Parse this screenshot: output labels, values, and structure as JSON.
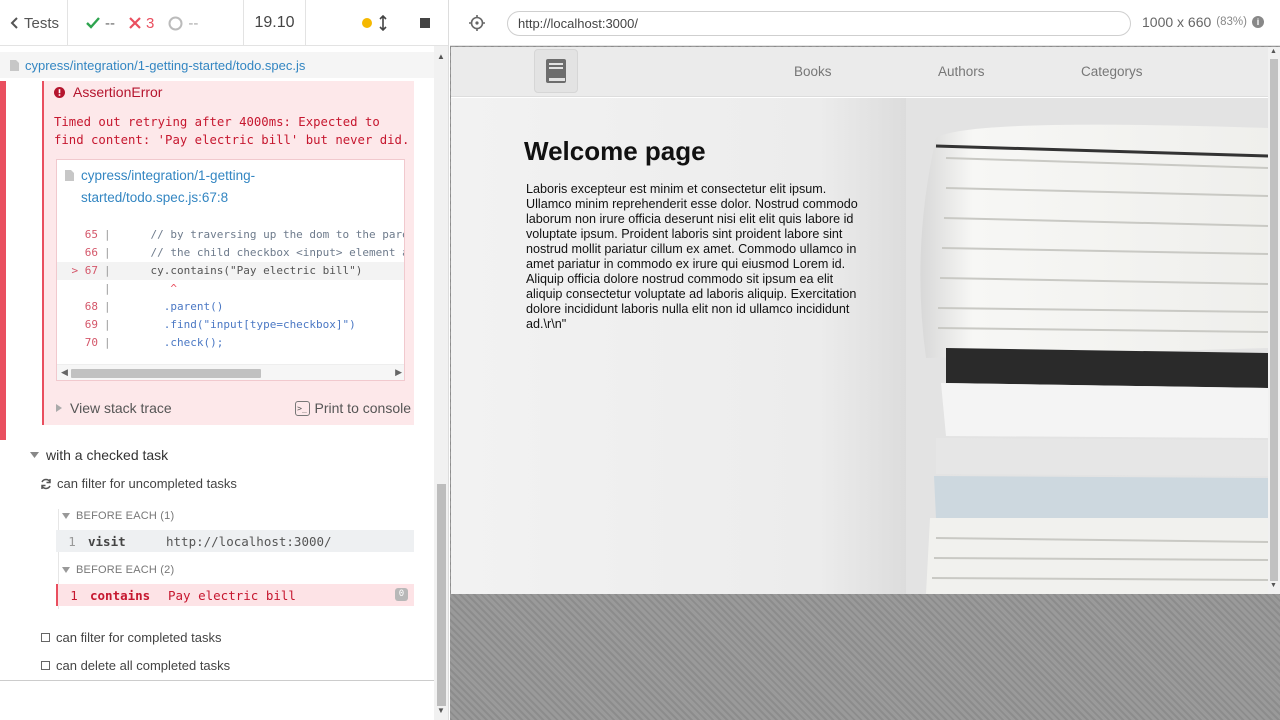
{
  "reporter": {
    "tests_label": "Tests",
    "stats": {
      "passed": "--",
      "failed": "3",
      "pending": "--"
    },
    "duration": "19.10",
    "spec_path": "cypress/integration/1-getting-started/todo.spec.js",
    "error": {
      "name": "AssertionError",
      "message": "Timed out retrying after 4000ms: Expected to\nfind content: 'Pay electric bill' but never did.",
      "file_link": "cypress/integration/1-getting-started/todo.spec.js:67:8",
      "code_lines": [
        {
          "num": "65",
          "marker": "",
          "text": "    // by traversing up the dom to the parent"
        },
        {
          "num": "66",
          "marker": "",
          "text": "    // the child checkbox <input> element and"
        },
        {
          "num": "67",
          "marker": ">",
          "text": "    cy.contains(\"Pay electric bill\")"
        },
        {
          "num": "",
          "marker": "",
          "text": "       ^"
        },
        {
          "num": "68",
          "marker": "",
          "text": "      .parent()"
        },
        {
          "num": "69",
          "marker": "",
          "text": "      .find(\"input[type=checkbox]\")"
        },
        {
          "num": "70",
          "marker": "",
          "text": "      .check();"
        }
      ],
      "view_stack_trace": "View stack trace",
      "print_to_console": "Print to console"
    },
    "suite_title": "with a checked task",
    "running_test": "can filter for uncompleted tasks",
    "hooks": [
      {
        "title": "BEFORE EACH (1)",
        "command": {
          "num": "1",
          "name": "visit",
          "message": "http://localhost:3000/"
        }
      },
      {
        "title": "BEFORE EACH (2)",
        "command": {
          "num": "1",
          "name": "contains",
          "message": "Pay electric bill",
          "badge": "0"
        }
      }
    ],
    "pending_tests": [
      "can filter for completed tasks",
      "can delete all completed tasks"
    ]
  },
  "aut": {
    "url": "http://localhost:3000/",
    "viewport": "1000 x 660",
    "scale": "(83%)",
    "info_icon": "i",
    "site": {
      "nav": [
        "Books",
        "Authors",
        "Categorys"
      ],
      "welcome_title": "Welcome page",
      "welcome_text": "Laboris excepteur est minim et consectetur elit ipsum. Ullamco minim reprehenderit esse dolor. Nostrud commodo laborum non irure officia deserunt nisi elit elit quis labore id voluptate ipsum. Proident laboris sint proident labore sint nostrud mollit pariatur cillum ex amet. Commodo ullamco in amet pariatur in commodo ex irure qui eiusmod Lorem id. Aliquip officia dolore nostrud commodo sit ipsum ea elit aliquip consectetur voluptate ad laboris aliquip. Exercitation dolore incididunt laboris nulla elit non id ullamco incididunt ad.\\r\\n\""
    }
  },
  "colors": {
    "pass": "#2ea44f",
    "fail": "#e94f5f",
    "link": "#3386c2",
    "running": "#f5b800"
  },
  "icons": [
    "chevron-left-icon",
    "check-icon",
    "x-icon",
    "circle-pending-icon",
    "running-dot-icon",
    "resize-icon",
    "stop-icon",
    "file-icon",
    "error-icon",
    "console-icon",
    "caret-down-icon",
    "refresh-icon",
    "selector-icon",
    "book-icon"
  ]
}
